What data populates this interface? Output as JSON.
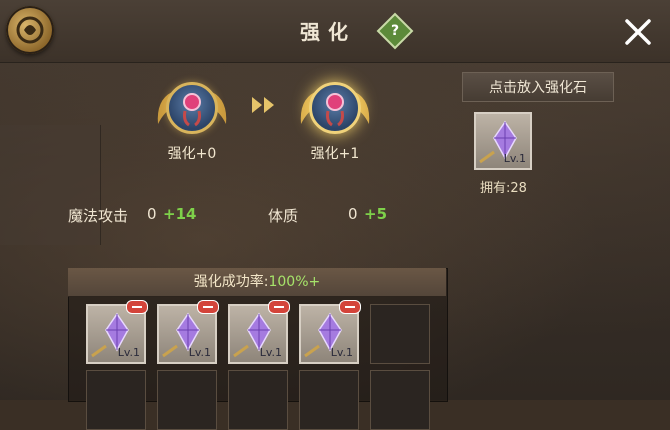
{
  "header": {
    "title": "强化"
  },
  "upgrade": {
    "current_label": "强化+0",
    "next_label": "强化+1"
  },
  "stats": [
    {
      "name": "魔法攻击",
      "base": "0",
      "bonus": "+14"
    },
    {
      "name": "体质",
      "base": "0",
      "bonus": "+5"
    }
  ],
  "sidebar": {
    "button_label": "点击放入强化石",
    "item_level": "Lv.1",
    "owned_label": "拥有:28"
  },
  "grid": {
    "rate_label": "强化成功率:",
    "rate_value": "100%+",
    "slots": [
      {
        "level": "Lv.1"
      },
      {
        "level": "Lv.1"
      },
      {
        "level": "Lv.1"
      },
      {
        "level": "Lv.1"
      }
    ]
  },
  "colors": {
    "accent_green": "#7ed14a",
    "rate_green": "#a6e36a",
    "remove_red": "#d3443a"
  },
  "icons": [
    "emblem-icon",
    "help-icon",
    "close-icon",
    "double-arrow-icon",
    "crystal-icon",
    "remove-icon"
  ]
}
